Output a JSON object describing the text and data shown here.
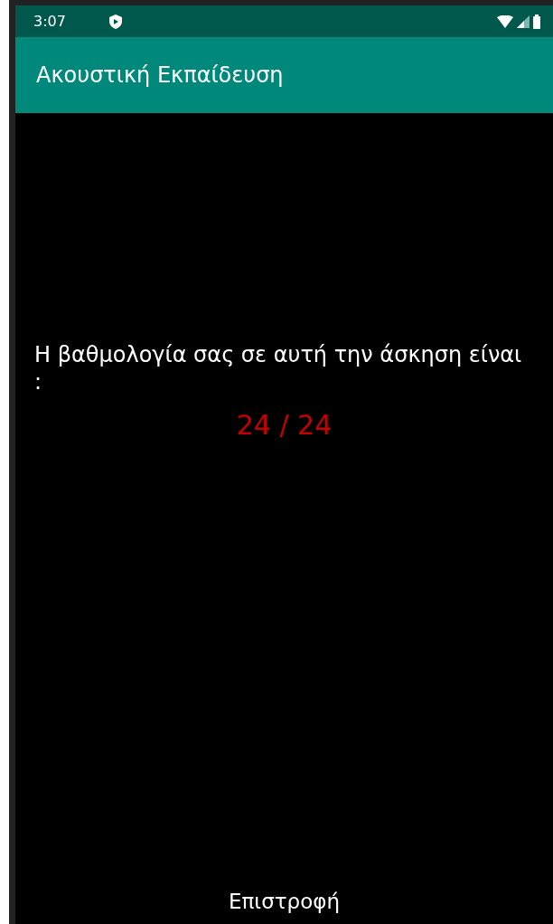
{
  "status_bar": {
    "time": "3:07"
  },
  "app_bar": {
    "title": "Ακουστική Εκπαίδευση"
  },
  "result": {
    "message": "Η βαθμολογία σας σε αυτή την άσκηση είναι :",
    "score": "24 / 24"
  },
  "buttons": [
    "Επιστροφή"
  ]
}
